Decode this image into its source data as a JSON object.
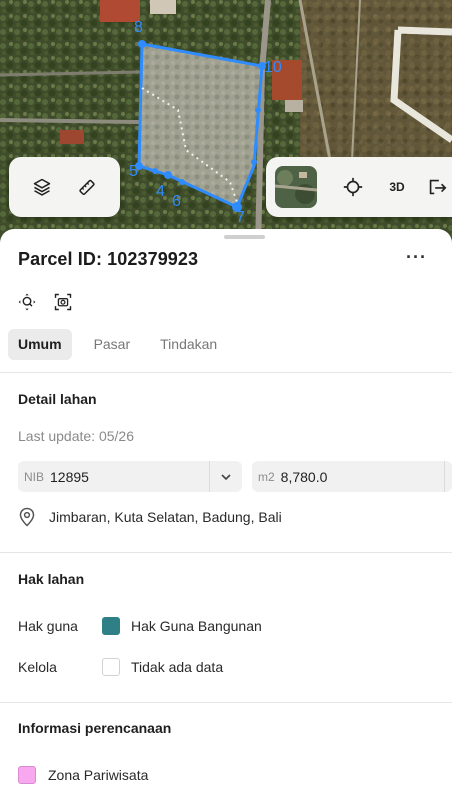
{
  "map": {
    "vertex_labels": [
      "8",
      "10",
      "5",
      "4",
      "6",
      "7"
    ],
    "icons": {
      "layers": "layers-icon",
      "measure": "measure-icon",
      "basemap": "basemap-thumbnail",
      "locate": "locate-icon",
      "share": "share-icon"
    },
    "btn_3d": "3D",
    "parcel_color": "#2f8cff"
  },
  "parcel": {
    "title": "Parcel ID: 102379923",
    "more": "···"
  },
  "tabs": [
    {
      "label": "Umum"
    },
    {
      "label": "Pasar"
    },
    {
      "label": "Tindakan"
    }
  ],
  "detail": {
    "heading": "Detail lahan",
    "last_update": "Last update: 05/26",
    "nib_prefix": "NIB",
    "nib_value": "12895",
    "area_prefix": "m2",
    "area_value": "8,780.0",
    "location": "Jimbaran, Kuta Selatan, Badung, Bali"
  },
  "hak": {
    "heading": "Hak lahan",
    "rows": [
      {
        "label": "Hak guna",
        "value": "Hak Guna Bangunan",
        "color": "#2f7f86"
      },
      {
        "label": "Kelola",
        "value": "Tidak ada data",
        "color": "#ffffff"
      }
    ]
  },
  "planning": {
    "heading": "Informasi perencanaan",
    "zone": "Zona Pariwisata",
    "zone_color": "#f7a8ee"
  }
}
